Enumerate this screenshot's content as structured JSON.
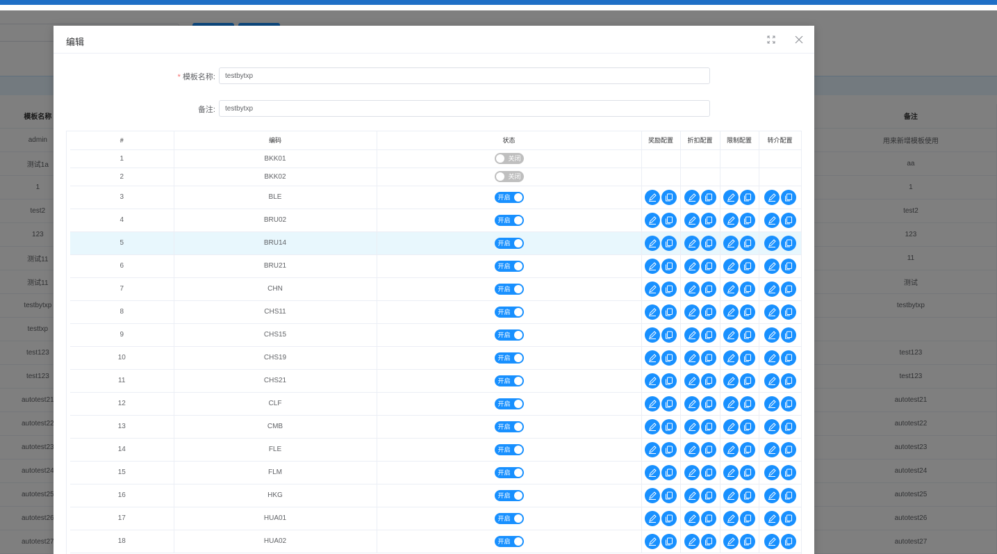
{
  "background": {
    "headers": [
      "模板名称",
      "备注"
    ],
    "rows": [
      [
        "admin",
        "用来新增模板使用"
      ],
      [
        "测试1a",
        "aa"
      ],
      [
        "1",
        "1"
      ],
      [
        "test2",
        "test2"
      ],
      [
        "123",
        "123"
      ],
      [
        "测试11",
        "11"
      ],
      [
        "测试11",
        "测试"
      ],
      [
        "testbytxp",
        "testbytxp"
      ],
      [
        "testtxp",
        ""
      ],
      [
        "test123",
        "test123"
      ],
      [
        "test123",
        "test123"
      ],
      [
        "autotest21",
        "autotest21"
      ],
      [
        "autotest22",
        "autotest22"
      ],
      [
        "autotest23",
        "autotest23"
      ],
      [
        "autotest24",
        "autotest24"
      ],
      [
        "autotest25",
        "autotest25"
      ],
      [
        "autotest26",
        "autotest26"
      ],
      [
        "autotest27",
        "autotest27"
      ]
    ]
  },
  "dialog": {
    "title": "编辑",
    "form": {
      "name_label": "模板名称:",
      "name_value": "testbytxp",
      "remark_label": "备注:",
      "remark_value": "testbytxp"
    },
    "table": {
      "headers": [
        "#",
        "编码",
        "状态",
        "奖励配置",
        "折扣配置",
        "限制配置",
        "转介配置"
      ],
      "switch_on_label": "开启",
      "switch_off_label": "关闭",
      "rows": [
        {
          "idx": "1",
          "code": "BKK01",
          "on": false
        },
        {
          "idx": "2",
          "code": "BKK02",
          "on": false
        },
        {
          "idx": "3",
          "code": "BLE",
          "on": true
        },
        {
          "idx": "4",
          "code": "BRU02",
          "on": true
        },
        {
          "idx": "5",
          "code": "BRU14",
          "on": true,
          "highlight": true
        },
        {
          "idx": "6",
          "code": "BRU21",
          "on": true
        },
        {
          "idx": "7",
          "code": "CHN",
          "on": true
        },
        {
          "idx": "8",
          "code": "CHS11",
          "on": true
        },
        {
          "idx": "9",
          "code": "CHS15",
          "on": true
        },
        {
          "idx": "10",
          "code": "CHS19",
          "on": true
        },
        {
          "idx": "11",
          "code": "CHS21",
          "on": true
        },
        {
          "idx": "12",
          "code": "CLF",
          "on": true
        },
        {
          "idx": "13",
          "code": "CMB",
          "on": true
        },
        {
          "idx": "14",
          "code": "FLE",
          "on": true
        },
        {
          "idx": "15",
          "code": "FLM",
          "on": true
        },
        {
          "idx": "16",
          "code": "HKG",
          "on": true
        },
        {
          "idx": "17",
          "code": "HUA01",
          "on": true
        },
        {
          "idx": "18",
          "code": "HUA02",
          "on": true
        }
      ]
    }
  },
  "colors": {
    "primary": "#1890ff",
    "topbar": "#1f6fc6",
    "switch_off": "#bfbfbf",
    "required": "#f56c6c"
  },
  "icons": [
    "maximize-icon",
    "close-icon",
    "edit-icon",
    "copy-icon"
  ]
}
